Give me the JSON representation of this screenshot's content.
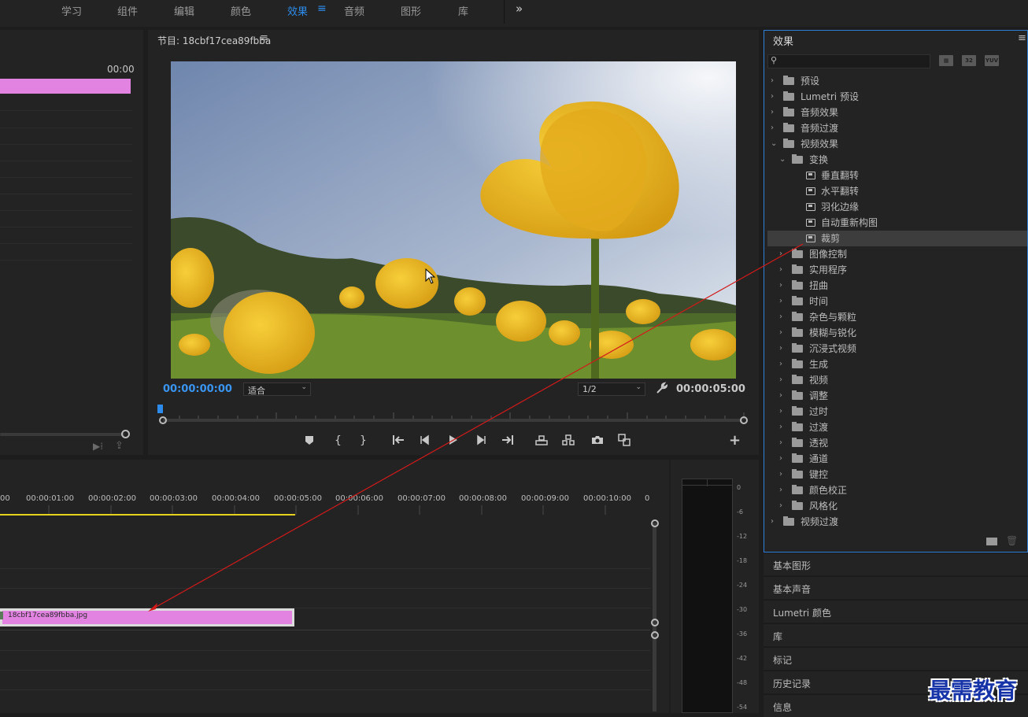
{
  "workspace_tabs": [
    {
      "label": "学习",
      "active": false
    },
    {
      "label": "组件",
      "active": false
    },
    {
      "label": "编辑",
      "active": false
    },
    {
      "label": "颜色",
      "active": false
    },
    {
      "label": "效果",
      "active": true
    },
    {
      "label": "音频",
      "active": false
    },
    {
      "label": "图形",
      "active": false
    },
    {
      "label": "库",
      "active": false
    }
  ],
  "workspace_menu_icon": "hamburger-icon",
  "overflow_icon": "double-chevron-right-icon",
  "source": {
    "timecode": "00:00"
  },
  "program": {
    "title": "节目: 18cbf17cea89fbba",
    "menu_icon": "hamburger-icon",
    "timecode_current": "00:00:00:00",
    "timecode_duration": "00:00:05:00",
    "zoom_value": "适合",
    "resolution_value": "1/2"
  },
  "effects": {
    "title": "效果",
    "search_placeholder": "",
    "badges": [
      "32",
      "YUV"
    ],
    "tree": [
      {
        "label": "预设",
        "level": 0,
        "expanded": false,
        "kind": "preset-folder"
      },
      {
        "label": "Lumetri 预设",
        "level": 0,
        "expanded": false,
        "kind": "preset-folder"
      },
      {
        "label": "音频效果",
        "level": 0,
        "expanded": false,
        "kind": "folder"
      },
      {
        "label": "音频过渡",
        "level": 0,
        "expanded": false,
        "kind": "folder"
      },
      {
        "label": "视频效果",
        "level": 0,
        "expanded": true,
        "kind": "folder"
      },
      {
        "label": "变换",
        "level": 1,
        "expanded": true,
        "kind": "folder"
      },
      {
        "label": "垂直翻转",
        "level": 2,
        "kind": "effect"
      },
      {
        "label": "水平翻转",
        "level": 2,
        "kind": "effect"
      },
      {
        "label": "羽化边缘",
        "level": 2,
        "kind": "effect"
      },
      {
        "label": "自动重新构图",
        "level": 2,
        "kind": "effect"
      },
      {
        "label": "裁剪",
        "level": 2,
        "kind": "effect",
        "selected": true
      },
      {
        "label": "图像控制",
        "level": 1,
        "expanded": false,
        "kind": "folder"
      },
      {
        "label": "实用程序",
        "level": 1,
        "expanded": false,
        "kind": "folder"
      },
      {
        "label": "扭曲",
        "level": 1,
        "expanded": false,
        "kind": "folder"
      },
      {
        "label": "时间",
        "level": 1,
        "expanded": false,
        "kind": "folder"
      },
      {
        "label": "杂色与颗粒",
        "level": 1,
        "expanded": false,
        "kind": "folder"
      },
      {
        "label": "模糊与锐化",
        "level": 1,
        "expanded": false,
        "kind": "folder"
      },
      {
        "label": "沉浸式视频",
        "level": 1,
        "expanded": false,
        "kind": "folder"
      },
      {
        "label": "生成",
        "level": 1,
        "expanded": false,
        "kind": "folder"
      },
      {
        "label": "视频",
        "level": 1,
        "expanded": false,
        "kind": "folder"
      },
      {
        "label": "调整",
        "level": 1,
        "expanded": false,
        "kind": "folder"
      },
      {
        "label": "过时",
        "level": 1,
        "expanded": false,
        "kind": "folder"
      },
      {
        "label": "过渡",
        "level": 1,
        "expanded": false,
        "kind": "folder"
      },
      {
        "label": "透视",
        "level": 1,
        "expanded": false,
        "kind": "folder"
      },
      {
        "label": "通道",
        "level": 1,
        "expanded": false,
        "kind": "folder"
      },
      {
        "label": "键控",
        "level": 1,
        "expanded": false,
        "kind": "folder"
      },
      {
        "label": "颜色校正",
        "level": 1,
        "expanded": false,
        "kind": "folder"
      },
      {
        "label": "风格化",
        "level": 1,
        "expanded": false,
        "kind": "folder"
      },
      {
        "label": "视频过渡",
        "level": 0,
        "expanded": false,
        "kind": "folder"
      }
    ]
  },
  "side_panels": [
    "基本图形",
    "基本声音",
    "Lumetri 颜色",
    "库",
    "标记",
    "历史记录",
    "信息"
  ],
  "timeline": {
    "ruler": [
      "00",
      "00:00:01:00",
      "00:00:02:00",
      "00:00:03:00",
      "00:00:04:00",
      "00:00:05:00",
      "00:00:06:00",
      "00:00:07:00",
      "00:00:08:00",
      "00:00:09:00",
      "00:00:10:00",
      "0"
    ],
    "clip_name": "18cbf17cea89fbba.jpg"
  },
  "meter_db": [
    "0",
    "-6",
    "-12",
    "-18",
    "-24",
    "-30",
    "-36",
    "-42",
    "-48",
    "-54"
  ],
  "watermark": "最需教育",
  "colors": {
    "accent": "#2d8ceb",
    "clip": "#e283e2",
    "annotation_arrow": "#d21a1a"
  }
}
